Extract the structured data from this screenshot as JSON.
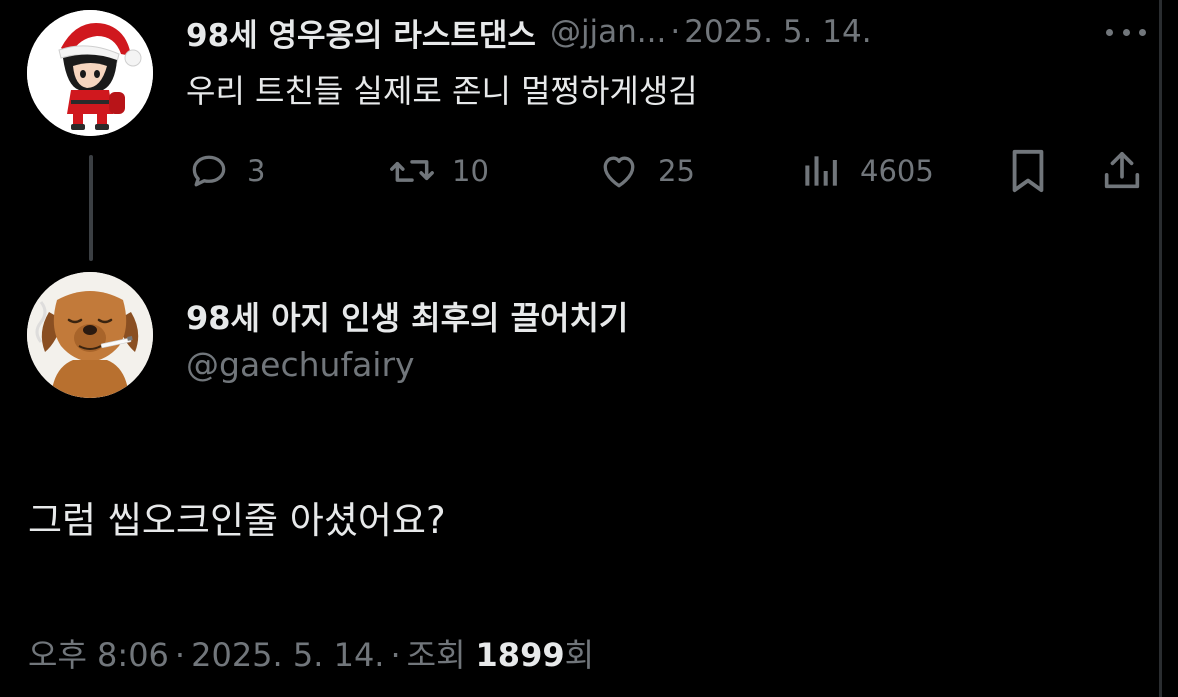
{
  "colors": {
    "background": "#000000",
    "text_primary": "#e7e9ea",
    "text_secondary": "#71767b",
    "thread_line": "#3b3f43"
  },
  "parent_tweet": {
    "author_name": "98세 영우옹의 라스트댄스",
    "handle": "@jjan...",
    "separator": "·",
    "date": "2025. 5. 14.",
    "text": "우리 트친들 실제로 존니 멀쩡하게생김",
    "avatar_icon": "santa-character-icon",
    "more_icon": "more-dots-icon",
    "actions": {
      "reply_count": "3",
      "retweet_count": "10",
      "like_count": "25",
      "view_count": "4605",
      "reply_icon": "reply-icon",
      "retweet_icon": "retweet-icon",
      "like_icon": "heart-icon",
      "views_icon": "views-bar-icon",
      "bookmark_icon": "bookmark-icon",
      "share_icon": "share-icon"
    }
  },
  "main_tweet": {
    "author_name": "98세 아지 인생 최후의 끌어치기",
    "handle": "@gaechufairy",
    "avatar_icon": "dog-avatar-icon",
    "text": "그럼 씹오크인줄 아셨어요?",
    "meta": {
      "time": "오후 8:06",
      "sep1": "·",
      "date": "2025. 5. 14.",
      "sep2": "·",
      "views_label": "조회",
      "views_count": "1899",
      "views_suffix": "회"
    }
  }
}
